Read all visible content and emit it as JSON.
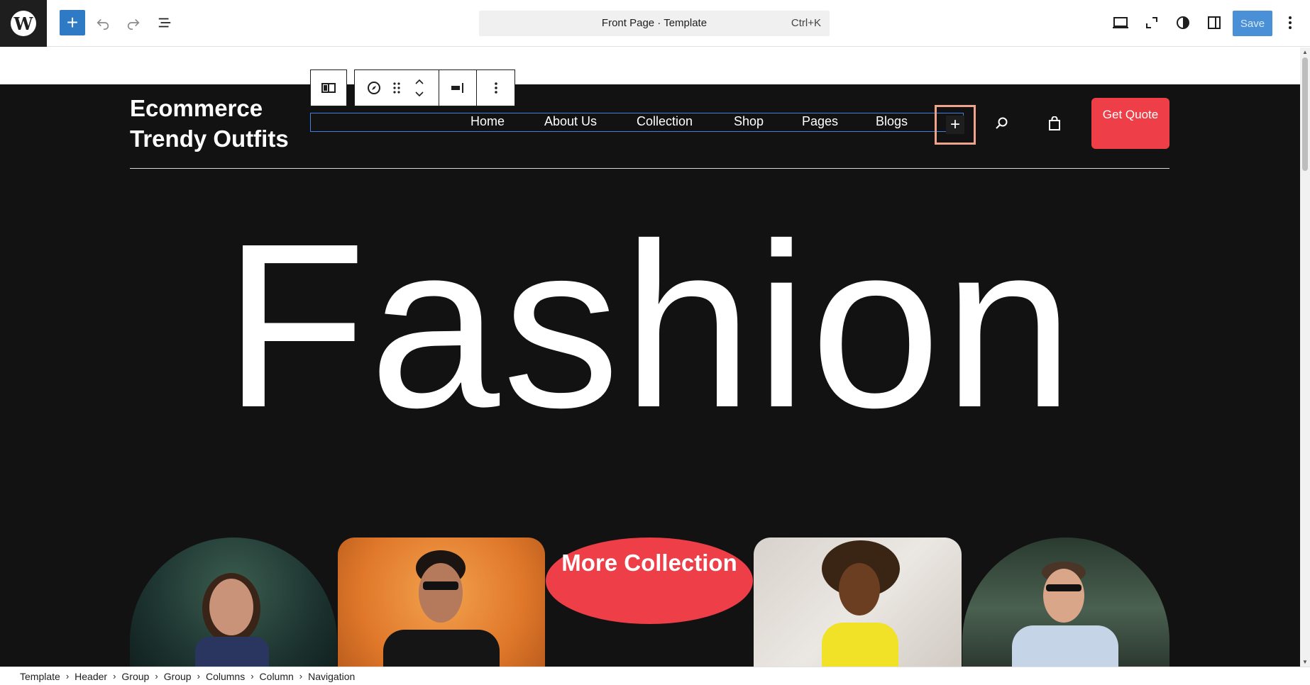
{
  "topbar": {
    "doc_title": "Front Page · Template",
    "shortcut": "Ctrl+K",
    "save_label": "Save",
    "add_label": "+"
  },
  "header": {
    "site_title": "Ecommerce Trendy Outfits",
    "nav": [
      "Home",
      "About Us",
      "Collection",
      "Shop",
      "Pages",
      "Blogs"
    ],
    "quote_button": "Get Quote"
  },
  "hero": {
    "heading": "Fashion",
    "more_collection": "More Collection"
  },
  "breadcrumb": [
    "Template",
    "Header",
    "Group",
    "Group",
    "Columns",
    "Column",
    "Navigation"
  ],
  "colors": {
    "accent": "#2f7ac4",
    "brand_red": "#ee3e47",
    "page_bg": "#121212"
  }
}
